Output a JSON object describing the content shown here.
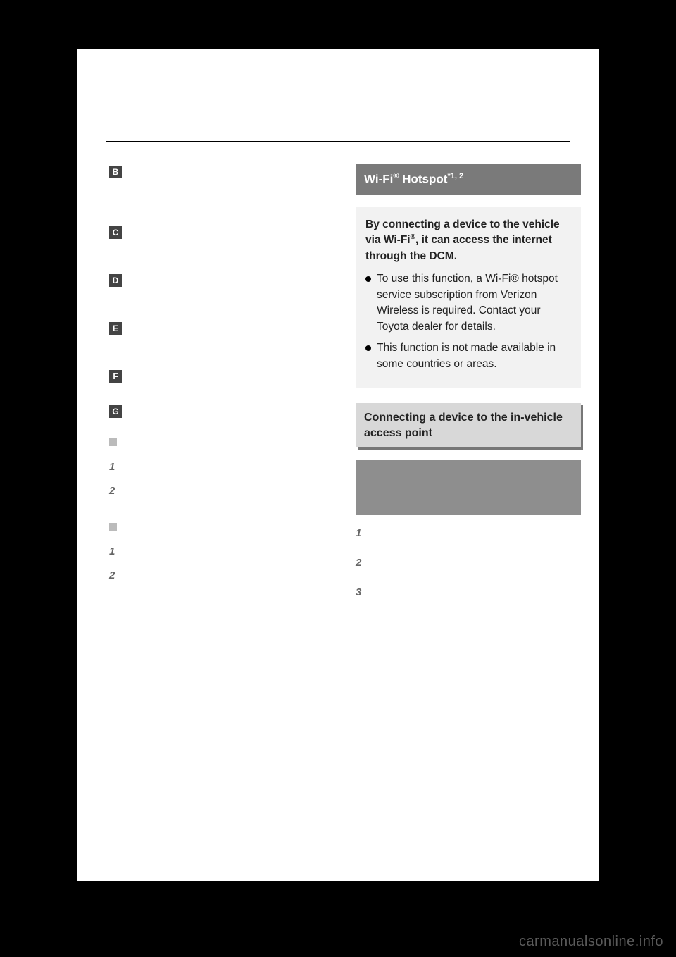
{
  "left": {
    "items": [
      {
        "marker": "B",
        "text": ""
      },
      {
        "marker": "C",
        "text": ""
      },
      {
        "marker": "D",
        "text": ""
      },
      {
        "marker": "E",
        "text": ""
      },
      {
        "marker": "F",
        "text": ""
      },
      {
        "marker": "G",
        "text": ""
      }
    ],
    "sub1": {
      "n1": "1",
      "n2": "2"
    },
    "sub2": {
      "n1": "1",
      "n2": "2"
    }
  },
  "right": {
    "title_prefix": "Wi-Fi",
    "title_suffix": " Hotspot",
    "title_sup": "*1, 2",
    "info_lead_a": "By connecting a device to the vehicle via Wi-Fi",
    "info_lead_b": ", it can access the internet through the DCM.",
    "info_bullets": [
      "To use this function, a Wi-Fi® hotspot service subscription from Verizon Wireless is required. Contact your Toyota dealer for details.",
      "This function is not made available in some countries or areas."
    ],
    "subhead": "Connecting a device to the in-vehicle access point",
    "steps": {
      "n1": "1",
      "n2": "2",
      "n3": "3"
    }
  },
  "watermark": "carmanualsonline.info"
}
